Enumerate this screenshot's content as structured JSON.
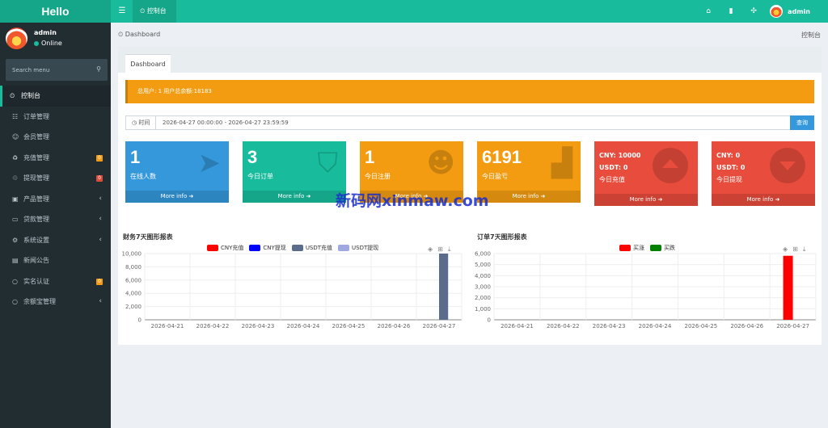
{
  "header": {
    "brand": "Hello",
    "tab_label": "控制台",
    "username": "admin"
  },
  "sidebar": {
    "user": {
      "name": "admin",
      "status": "Online"
    },
    "search_placeholder": "Search menu",
    "items": [
      {
        "label": "控制台",
        "icon": "dashboard-icon",
        "active": true
      },
      {
        "label": "订单管理",
        "icon": "list-icon"
      },
      {
        "label": "会员管理",
        "icon": "users-icon"
      },
      {
        "label": "充值管理",
        "icon": "recharge-icon",
        "badge": "0",
        "badge_color": "#f39c12"
      },
      {
        "label": "提现管理",
        "icon": "withdraw-icon",
        "badge": "0",
        "badge_color": "#dd4b39"
      },
      {
        "label": "产品管理",
        "icon": "product-icon",
        "chevron": true
      },
      {
        "label": "贷款管理",
        "icon": "card-icon",
        "chevron": true
      },
      {
        "label": "系统设置",
        "icon": "cogs-icon",
        "chevron": true
      },
      {
        "label": "新闻公告",
        "icon": "news-icon"
      },
      {
        "label": "实名认证",
        "icon": "circle-icon",
        "badge": "0",
        "badge_color": "#f39c12"
      },
      {
        "label": "余额宝管理",
        "icon": "circle-icon",
        "chevron": true
      }
    ]
  },
  "content": {
    "breadcrumb": "Dashboard",
    "page_title": "控制台",
    "tab": "Dashboard",
    "alert": "总用户: 1     用户总余额:18183",
    "filter": {
      "label": "时间",
      "value": "2026-04-27 00:00:00 - 2026-04-27 23:59:59",
      "button": "查询"
    },
    "boxes": [
      {
        "number": "1",
        "label": "在线人数",
        "footer": "More info",
        "color": "#3498db",
        "icon": "paper-plane-icon"
      },
      {
        "number": "3",
        "label": "今日订单",
        "footer": "More info",
        "color": "#18bc9c",
        "icon": "shopping-bag-icon"
      },
      {
        "number": "1",
        "label": "今日注册",
        "footer": "More info",
        "color": "#f39c12",
        "icon": "user-plus-icon"
      },
      {
        "number": "6191",
        "label": "今日盈亏",
        "footer": "More info",
        "color": "#f39c12",
        "icon": "bar-chart-icon"
      },
      {
        "cny": "CNY: 10000",
        "usdt": "USDT: 0",
        "label": "今日充值",
        "footer": "More info",
        "color": "#e74c3c",
        "icon": "arrow-up-circle-icon"
      },
      {
        "cny": "CNY: 0",
        "usdt": "USDT: 0",
        "label": "今日提现",
        "footer": "More info",
        "color": "#e74c3c",
        "icon": "arrow-down-circle-icon"
      }
    ],
    "watermark": "新码网xinmaw.com"
  },
  "chart_data": [
    {
      "type": "bar",
      "title": "财务7天图形报表",
      "categories": [
        "2026-04-21",
        "2026-04-22",
        "2026-04-23",
        "2026-04-24",
        "2026-04-25",
        "2026-04-26",
        "2026-04-27"
      ],
      "series": [
        {
          "name": "CNY充值",
          "color": "#ff0000",
          "values": [
            0,
            0,
            0,
            0,
            0,
            0,
            0
          ]
        },
        {
          "name": "CNY提现",
          "color": "#0000ff",
          "values": [
            0,
            0,
            0,
            0,
            0,
            0,
            0
          ]
        },
        {
          "name": "USDT充值",
          "color": "#5b6b8c",
          "values": [
            0,
            0,
            0,
            0,
            0,
            0,
            10000
          ]
        },
        {
          "name": "USDT提现",
          "color": "#a0a8e0",
          "values": [
            0,
            0,
            0,
            0,
            0,
            0,
            0
          ]
        }
      ],
      "yticks": [
        "0",
        "2,000",
        "4,000",
        "6,000",
        "8,000",
        "10,000"
      ],
      "ylim": [
        0,
        10000
      ],
      "legend": "top"
    },
    {
      "type": "bar",
      "title": "订单7天图形报表",
      "categories": [
        "2026-04-21",
        "2026-04-22",
        "2026-04-23",
        "2026-04-24",
        "2026-04-25",
        "2026-04-26",
        "2026-04-27"
      ],
      "series": [
        {
          "name": "买涨",
          "color": "#ff0000",
          "values": [
            0,
            0,
            0,
            0,
            0,
            0,
            5800
          ]
        },
        {
          "name": "买跌",
          "color": "#008000",
          "values": [
            0,
            0,
            0,
            0,
            0,
            0,
            0
          ]
        }
      ],
      "yticks": [
        "0",
        "1,000",
        "2,000",
        "3,000",
        "4,000",
        "5,000",
        "6,000"
      ],
      "ylim": [
        0,
        6000
      ],
      "legend": "top"
    }
  ]
}
